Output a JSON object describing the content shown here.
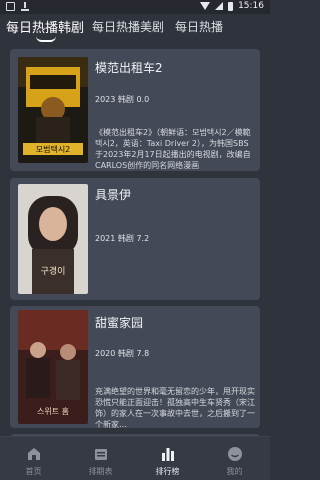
{
  "status_bar": {
    "time": "15:16"
  },
  "top_tabs": [
    {
      "label": "每日热播韩剧",
      "active": true
    },
    {
      "label": "每日热播美剧",
      "active": false
    },
    {
      "label": "每日热播",
      "active": false
    }
  ],
  "shows": [
    {
      "title": "模范出租车2",
      "meta": "2023 韩剧 0.0",
      "description": "《模范出租车2》（朝鲜语：모범택시2／模範택시2，英语：Taxi Driver 2），为韩国SBS于2023年2月17日起播出的电视剧，改编自CARLOS创作的同名网络漫画",
      "poster_text": "모범택시2"
    },
    {
      "title": "具景伊",
      "meta": "2021 韩剧 7.2",
      "description": "",
      "poster_text": "구경이"
    },
    {
      "title": "甜蜜家园",
      "meta": "2020 韩剧 7.8",
      "description": "充满绝望的世界和毫无留恋的少年，甩开现实恐慌只能正面迎击！孤独高中生车贤秀（宋江 饰）的家人在一次事故中去世，之后搬到了一个新家…",
      "poster_text": "스위트 홈"
    }
  ],
  "bottom_nav": [
    {
      "label": "首页",
      "icon": "home-icon",
      "active": false
    },
    {
      "label": "排期表",
      "icon": "calendar-icon",
      "active": false
    },
    {
      "label": "排行榜",
      "icon": "bar-chart-icon",
      "active": true
    },
    {
      "label": "我的",
      "icon": "profile-icon",
      "active": false
    }
  ]
}
